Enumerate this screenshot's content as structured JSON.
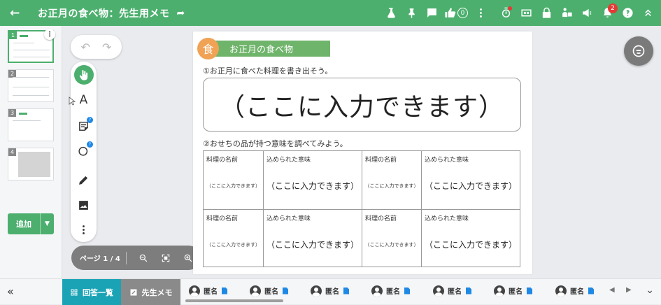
{
  "app": {
    "title": "お正月の食べ物：先生用メモ",
    "like_count": "0",
    "notification_count": "2",
    "colors": {
      "brand": "#4caf6e",
      "accent_tab": "#1aa3b5",
      "badge": "#e53935"
    }
  },
  "icons": [
    "arrow-back-icon",
    "share-icon",
    "lab-icon",
    "pin-icon",
    "comment-icon",
    "thumbs-up-icon",
    "more-vert-icon",
    "timer-icon",
    "visibility-icon",
    "lock-icon",
    "presentation-icon",
    "megaphone-icon",
    "bell-icon",
    "help-icon",
    "collapse-up-icon"
  ],
  "sidebar": {
    "pages": [
      {
        "num": "1"
      },
      {
        "num": "2"
      },
      {
        "num": "3"
      },
      {
        "num": "4"
      }
    ],
    "add_label": "追加"
  },
  "toolbar": {
    "text_tool_label": "A"
  },
  "page_nav": {
    "label": "ページ 1 / 4"
  },
  "worksheet": {
    "heading_icon_char": "食",
    "heading": "お正月の食べ物",
    "q1": "①お正月に食べた料理を書き出そう。",
    "q1_placeholder": "（ここに入力できます）",
    "q2": "②おせちの品が持つ意味を調べてみよう。",
    "table": {
      "col_name": "料理の名前",
      "col_meaning": "込められた意味",
      "small_placeholder": "（ここに入力できます）",
      "placeholder": "（ここに入力できます）"
    }
  },
  "bottom": {
    "answers_tab": "回答一覧",
    "memo_tab": "先生メモ",
    "students": [
      "匿名",
      "匿名",
      "匿名",
      "匿名",
      "匿名",
      "匿名",
      "匿名"
    ]
  }
}
